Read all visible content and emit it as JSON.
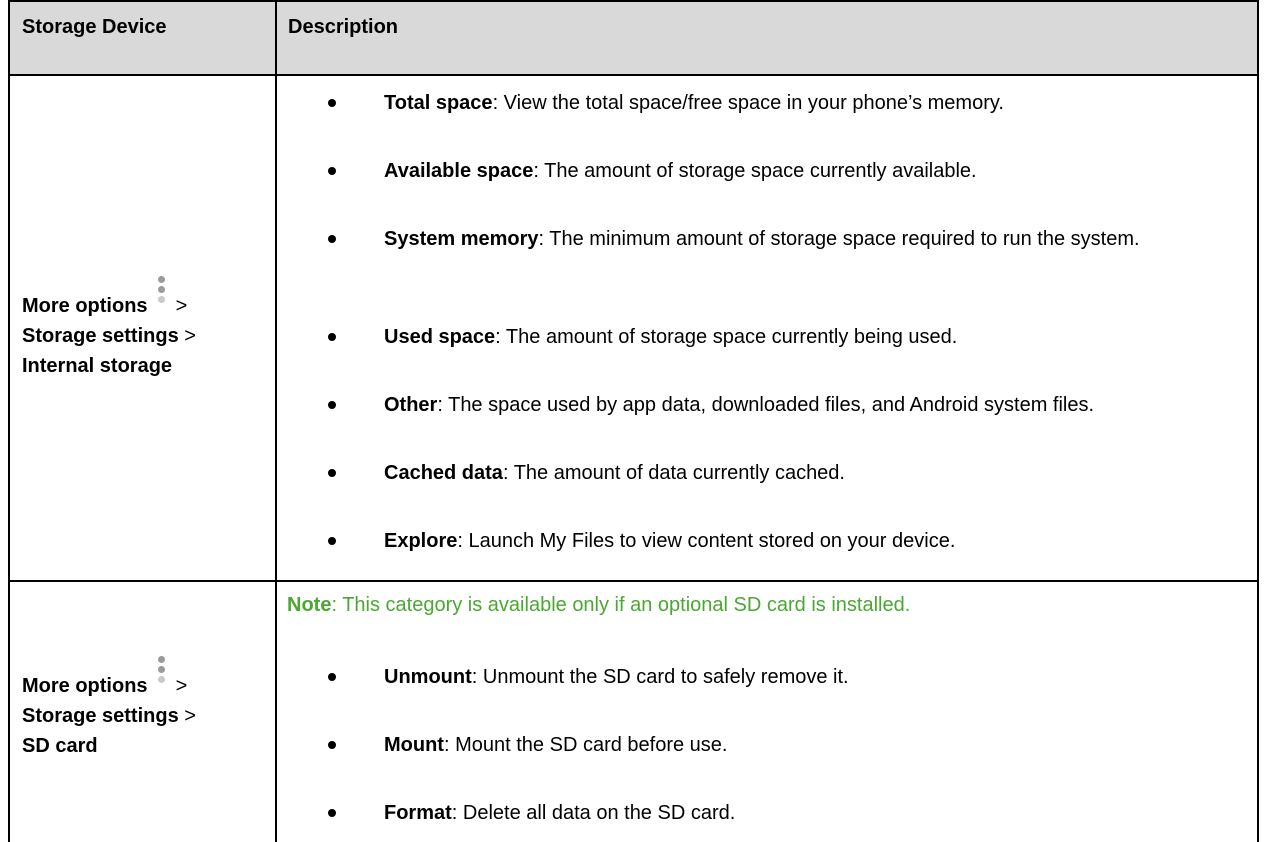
{
  "table": {
    "headers": {
      "col1": "Storage Device",
      "col2": "Description"
    },
    "rows": [
      {
        "left": {
          "part1": "More options",
          "sep1": ">",
          "part2": "Storage settings",
          "sep2": ">",
          "part3": "Internal storage"
        },
        "items": [
          {
            "term": "Total space",
            "desc": ": View the total space/free space in your phone’s memory."
          },
          {
            "term": "Available space",
            "desc": ": The amount of storage space currently available."
          },
          {
            "term": "System memory",
            "desc": ": The minimum amount of storage space required to run the system."
          },
          {
            "term": "Used space",
            "desc": ": The amount of storage space currently being used."
          },
          {
            "term": "Other",
            "desc": ": The space used by app data, downloaded files, and Android system files."
          },
          {
            "term": "Cached data",
            "desc": ": The amount of data currently cached."
          },
          {
            "term": "Explore",
            "desc": ": Launch My Files to view content stored on your device."
          }
        ]
      },
      {
        "left": {
          "part1": "More options",
          "sep1": ">",
          "part2": "Storage settings",
          "sep2": ">",
          "part3": "SD card"
        },
        "note": {
          "label": "Note",
          "text": ": This category is available only if an optional SD card is installed."
        },
        "items": [
          {
            "term": "Unmount",
            "desc": ": Unmount the SD card to safely remove it."
          },
          {
            "term": "Mount",
            "desc": ": Mount the SD card before use."
          },
          {
            "term": "Format",
            "desc": ": Delete all data on the SD card."
          }
        ]
      }
    ]
  },
  "colors": {
    "note": "#4aa832",
    "icon": "#9a9a9a"
  },
  "icons": {
    "more_options": "more-options-vertical-dots-icon"
  }
}
